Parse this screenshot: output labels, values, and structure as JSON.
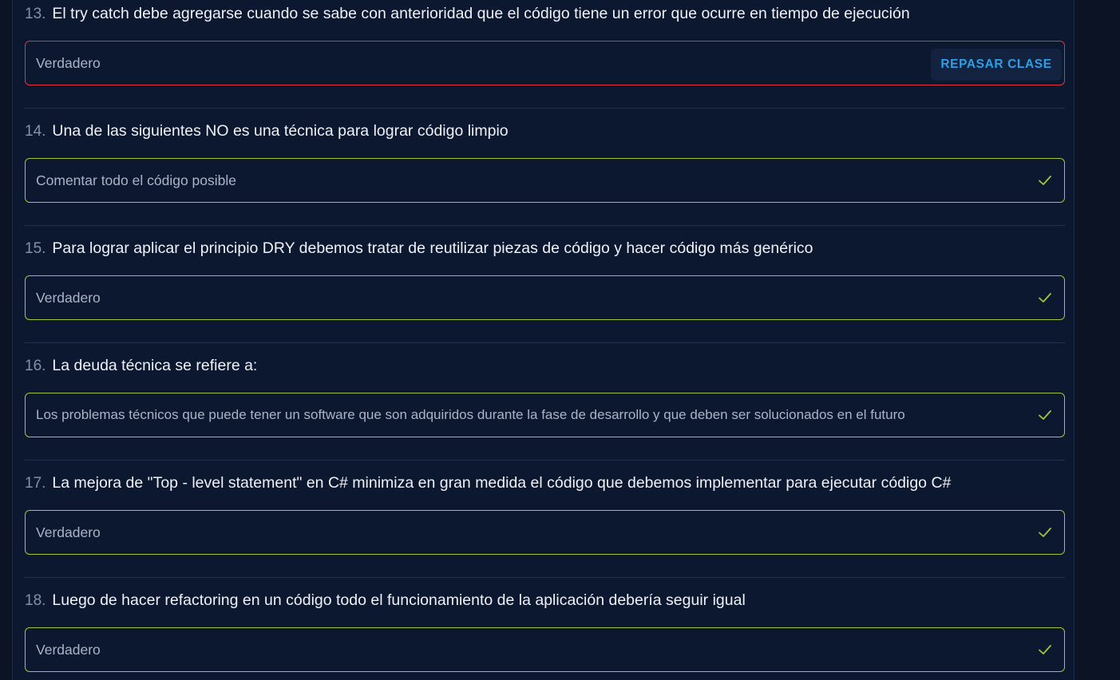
{
  "questions": [
    {
      "number": "13.",
      "text": "El try catch debe agregarse cuando se sabe con anterioridad que el código tiene un error que ocurre en tiempo de ejecución",
      "answer": "Verdadero",
      "status": "incorrect",
      "review_label": "REPASAR CLASE"
    },
    {
      "number": "14.",
      "text": "Una de las siguientes NO es una técnica para lograr código limpio",
      "answer": "Comentar todo el código posible",
      "status": "correct",
      "icon": "check-icon"
    },
    {
      "number": "15.",
      "text": "Para lograr aplicar el principio DRY debemos tratar de reutilizar piezas de código y hacer código más genérico",
      "answer": "Verdadero",
      "status": "correct",
      "icon": "check-icon"
    },
    {
      "number": "16.",
      "text": "La deuda técnica se refiere a:",
      "answer": "Los problemas técnicos que puede tener un software que son adquiridos durante la fase de desarrollo y que deben ser solucionados en el futuro",
      "status": "correct",
      "icon": "check-icon"
    },
    {
      "number": "17.",
      "text": "La mejora de \"Top - level statement\" en C# minimiza en gran medida el código que debemos implementar para ejecutar código C#",
      "answer": "Verdadero",
      "status": "correct",
      "icon": "check-icon"
    },
    {
      "number": "18.",
      "text": "Luego de hacer refactoring en un código todo el funcionamiento de la aplicación debería seguir igual",
      "answer": "Verdadero",
      "status": "correct",
      "icon": "check-icon"
    }
  ],
  "colors": {
    "background": "#0b1325",
    "panel": "#0c1730",
    "correct_border": "#a4c43c",
    "wrong_border": "#e0343c",
    "button_text": "#2c9fe8"
  }
}
